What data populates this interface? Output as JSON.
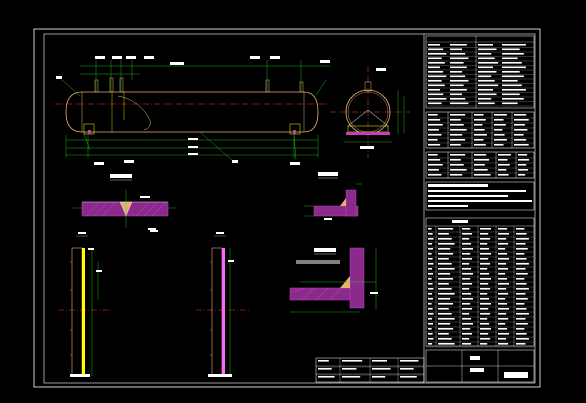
{
  "drawing": {
    "view_a_label": "A",
    "view_b_label": "B",
    "colors": {
      "background": "#000000",
      "frame": "#ffffff",
      "vessel": "#e8b070",
      "dimension": "#22dd22",
      "centerline": "#ff3333",
      "hatch": "#c040c0",
      "annotation": "#ffff00",
      "table_line": "#ffffff",
      "text": "#ffffff"
    },
    "icons": [
      "vessel-elevation-icon",
      "vessel-end-view-icon",
      "weld-detail-icon",
      "nozzle-detail-icon"
    ]
  }
}
